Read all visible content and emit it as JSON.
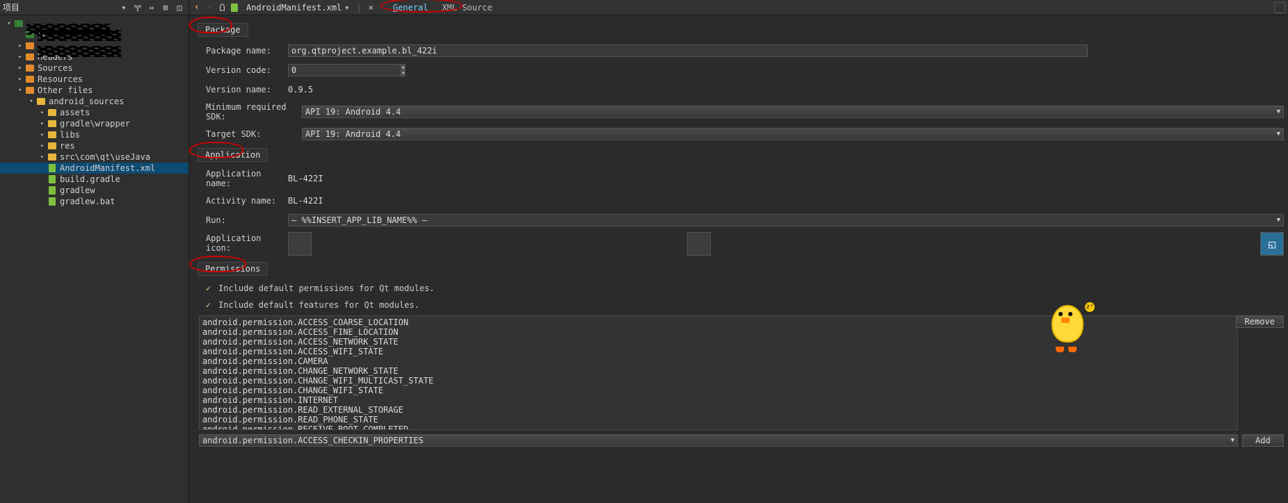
{
  "sidebar": {
    "title": "项目",
    "toolbar_icons": [
      "dropdown",
      "filter",
      "link",
      "add-panel",
      "split"
    ],
    "tree": [
      {
        "indent": 0,
        "arrow": "▾",
        "icon": "project",
        "label": "",
        "scribble": true
      },
      {
        "indent": 1,
        "arrow": "",
        "icon": "project",
        "label": "ro",
        "scribble": true
      },
      {
        "indent": 1,
        "arrow": "▸",
        "icon": "folder",
        "label": "",
        "scribble": true
      },
      {
        "indent": 1,
        "arrow": "▸",
        "icon": "folder",
        "label": "Headers"
      },
      {
        "indent": 1,
        "arrow": "▸",
        "icon": "folder",
        "label": "Sources"
      },
      {
        "indent": 1,
        "arrow": "▸",
        "icon": "folder",
        "label": "Resources"
      },
      {
        "indent": 1,
        "arrow": "▾",
        "icon": "folder",
        "label": "Other files"
      },
      {
        "indent": 2,
        "arrow": "▾",
        "icon": "folder-y",
        "label": "android_sources"
      },
      {
        "indent": 3,
        "arrow": "▸",
        "icon": "folder-y",
        "label": "assets"
      },
      {
        "indent": 3,
        "arrow": "▸",
        "icon": "folder-y",
        "label": "gradle\\wrapper"
      },
      {
        "indent": 3,
        "arrow": "▸",
        "icon": "folder-y",
        "label": "libs"
      },
      {
        "indent": 3,
        "arrow": "▸",
        "icon": "folder-y",
        "label": "res"
      },
      {
        "indent": 3,
        "arrow": "▸",
        "icon": "folder-y",
        "label": "src\\com\\qt\\useJava"
      },
      {
        "indent": 3,
        "arrow": "",
        "icon": "xml",
        "label": "AndroidManifest.xml",
        "selected": true
      },
      {
        "indent": 3,
        "arrow": "",
        "icon": "gradle",
        "label": "build.gradle"
      },
      {
        "indent": 3,
        "arrow": "",
        "icon": "gradle",
        "label": "gradlew"
      },
      {
        "indent": 3,
        "arrow": "",
        "icon": "bat",
        "label": "gradlew.bat"
      }
    ]
  },
  "editor": {
    "filename": "AndroidManifest.xml",
    "tabs": {
      "general": "General",
      "xml": "XML Source"
    },
    "active_tab": "general",
    "sections": {
      "package": {
        "title": "Package",
        "package_name_label": "Package name:",
        "package_name_value": "org.qtproject.example.bl_422i",
        "version_code_label": "Version code:",
        "version_code_value": "0",
        "version_name_label": "Version name:",
        "version_name_value": "0.9.5",
        "min_sdk_label": "Minimum required SDK:",
        "min_sdk_value": "API 19: Android 4.4",
        "target_sdk_label": "Target SDK:",
        "target_sdk_value": "API 19: Android 4.4"
      },
      "application": {
        "title": "Application",
        "app_name_label": "Application name:",
        "app_name_value": "BL-422I",
        "activity_name_label": "Activity name:",
        "activity_name_value": "BL-422I",
        "run_label": "Run:",
        "run_value": "— %%INSERT_APP_LIB_NAME%% —",
        "icon_label": "Application icon:"
      },
      "permissions": {
        "title": "Permissions",
        "include_perm_label": "Include default permissions for Qt modules.",
        "include_feat_label": "Include default features for Qt modules.",
        "list": [
          "android.permission.ACCESS_COARSE_LOCATION",
          "android.permission.ACCESS_FINE_LOCATION",
          "android.permission.ACCESS_NETWORK_STATE",
          "android.permission.ACCESS_WIFI_STATE",
          "android.permission.CAMERA",
          "android.permission.CHANGE_NETWORK_STATE",
          "android.permission.CHANGE_WIFI_MULTICAST_STATE",
          "android.permission.CHANGE_WIFI_STATE",
          "android.permission.INTERNET",
          "android.permission.READ_EXTERNAL_STORAGE",
          "android.permission.READ_PHONE_STATE",
          "android.permission.RECEIVE_BOOT_COMPLETED"
        ],
        "remove_btn": "Remove",
        "add_select_value": "android.permission.ACCESS_CHECKIN_PROPERTIES",
        "add_btn": "Add"
      }
    }
  }
}
